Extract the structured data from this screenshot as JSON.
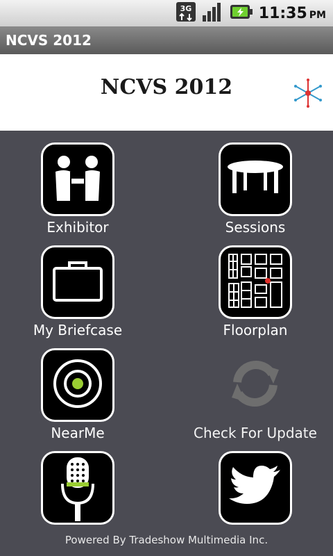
{
  "status_bar": {
    "network_label": "3G",
    "time": "11:35",
    "ampm": "PM"
  },
  "app": {
    "title": "NCVS 2012"
  },
  "banner": {
    "title": "NCVS 2012"
  },
  "tiles": [
    {
      "label": "Exhibitor",
      "icon": "handshake-icon"
    },
    {
      "label": "Sessions",
      "icon": "table-icon"
    },
    {
      "label": "My Briefcase",
      "icon": "briefcase-icon"
    },
    {
      "label": "Floorplan",
      "icon": "floorplan-icon"
    },
    {
      "label": "NearMe",
      "icon": "target-icon"
    },
    {
      "label": "Check For Update",
      "icon": "refresh-icon"
    },
    {
      "label": "",
      "icon": "microphone-icon"
    },
    {
      "label": "",
      "icon": "twitter-bird-icon"
    }
  ],
  "footer": {
    "text": "Powered By Tradeshow Multimedia Inc."
  },
  "colors": {
    "background": "#4b4b53",
    "tile_bg": "#000000",
    "tile_border": "#ffffff",
    "accent_green": "#9acd32",
    "accent_red": "#e0302a"
  }
}
